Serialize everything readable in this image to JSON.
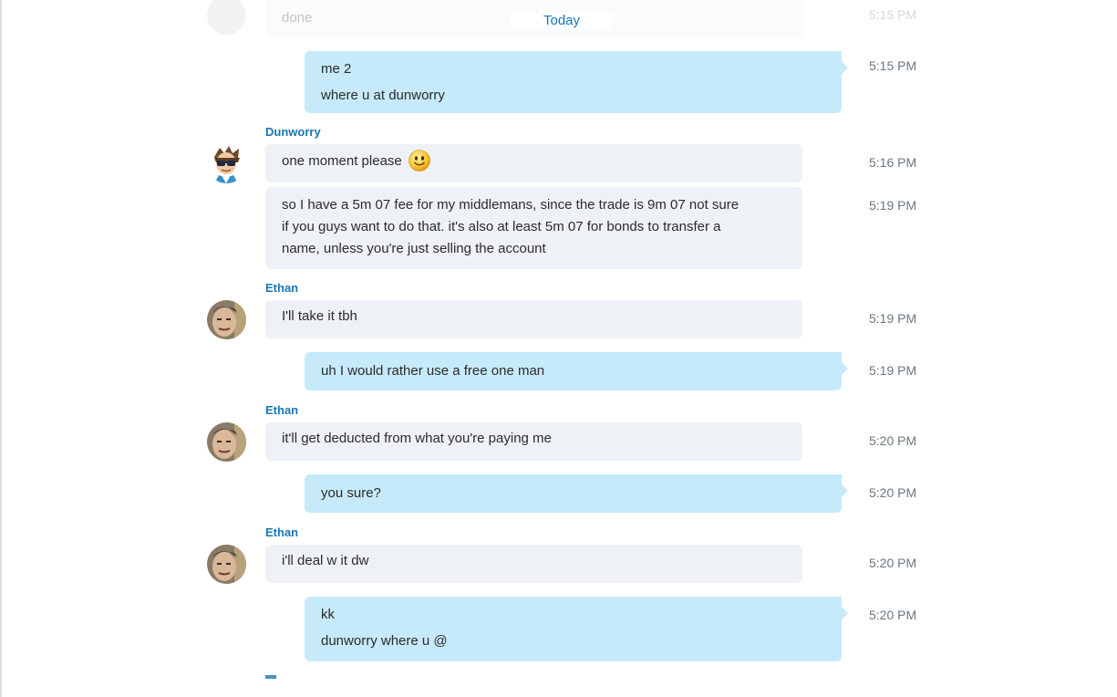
{
  "date_divider": "Today",
  "top_faded": {
    "text": "done",
    "time": "5:15 PM"
  },
  "messages": [
    {
      "dir": "out",
      "lines": [
        "me 2",
        "where u at dunworry"
      ],
      "time": "5:15 PM"
    },
    {
      "sender": "Dunworry",
      "avatar": "dunworry-avatar"
    },
    {
      "dir": "in",
      "lines": [
        "one moment please"
      ],
      "emoji": "smiley-emoji",
      "time": "5:16 PM"
    },
    {
      "dir": "in",
      "lines": [
        "so I have a 5m 07 fee for my middlemans, since the trade is 9m 07 not sure",
        "if you guys want to do that. it's also at least 5m 07 for bonds to transfer a",
        "name, unless you're just selling the account"
      ],
      "time": "5:19 PM"
    },
    {
      "sender": "Ethan",
      "avatar": "ethan-avatar"
    },
    {
      "dir": "in",
      "lines": [
        "I'll take it tbh"
      ],
      "time": "5:19 PM"
    },
    {
      "dir": "out",
      "lines": [
        "uh I would rather use a free one man"
      ],
      "time": "5:19 PM"
    },
    {
      "sender": "Ethan",
      "avatar": "ethan-avatar"
    },
    {
      "dir": "in",
      "lines": [
        "it'll get deducted from what you're paying me"
      ],
      "time": "5:20 PM"
    },
    {
      "dir": "out",
      "lines": [
        "you sure?"
      ],
      "time": "5:20 PM"
    },
    {
      "sender": "Ethan",
      "avatar": "ethan-avatar"
    },
    {
      "dir": "in",
      "lines": [
        "i'll deal w it dw"
      ],
      "time": "5:20 PM"
    },
    {
      "dir": "out",
      "lines": [
        "kk",
        "dunworry where u @"
      ],
      "time": "5:20 PM"
    }
  ],
  "colors": {
    "incoming_bubble": "#eef2f6",
    "outgoing_bubble": "#c7eafa",
    "sender_name": "#1a76b5",
    "timestamp": "#6b7682"
  }
}
